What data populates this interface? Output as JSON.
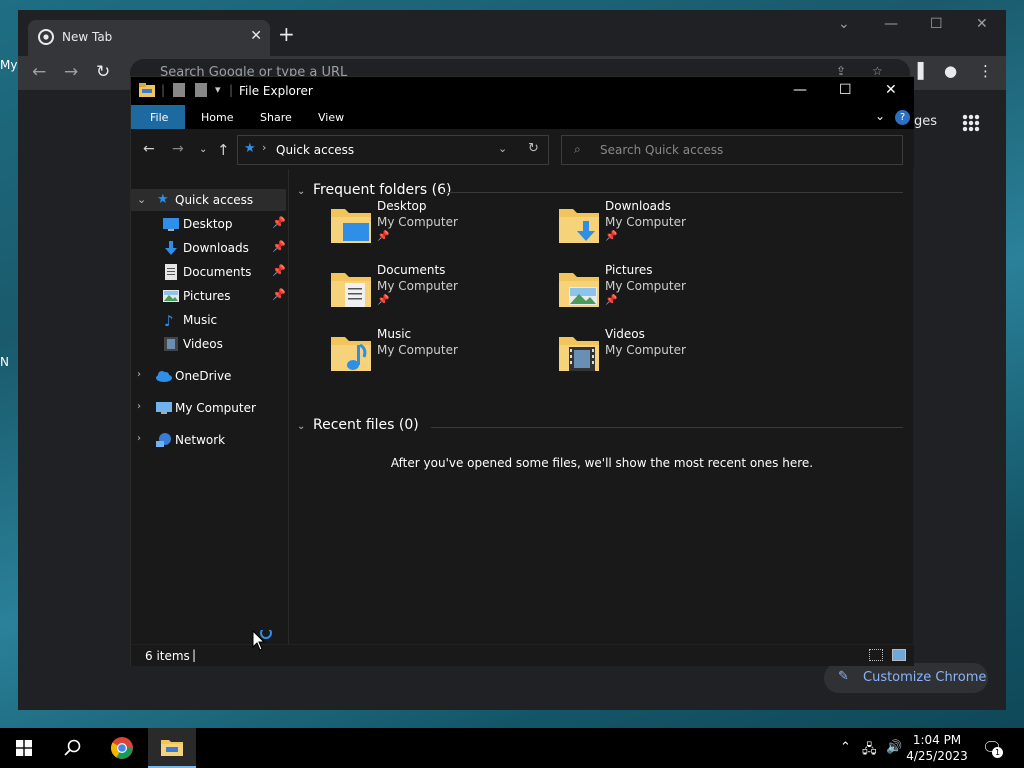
{
  "desktop": {
    "fragments": [
      "My",
      "N"
    ]
  },
  "chrome": {
    "tab_title": "New Tab",
    "tab_close": "✕",
    "new_tab": "+",
    "omnibox_placeholder": "Search Google or type a URL",
    "images_link_fragment": "ges",
    "customize_label": "Customize Chrome",
    "colors": {
      "frame": "#202124",
      "toolbar": "#35363a",
      "accent": "#8ab4f8"
    }
  },
  "explorer": {
    "title": "File Explorer",
    "ribbon_tabs": [
      "File",
      "Home",
      "Share",
      "View"
    ],
    "address_location": "Quick access",
    "search_placeholder": "Search Quick access",
    "nav": {
      "quick_access": "Quick access",
      "pinned": [
        {
          "label": "Desktop",
          "pinned": true,
          "icon": "desktop-icon"
        },
        {
          "label": "Downloads",
          "pinned": true,
          "icon": "downloads-icon"
        },
        {
          "label": "Documents",
          "pinned": true,
          "icon": "documents-icon"
        },
        {
          "label": "Pictures",
          "pinned": true,
          "icon": "pictures-icon"
        },
        {
          "label": "Music",
          "pinned": false,
          "icon": "music-icon"
        },
        {
          "label": "Videos",
          "pinned": false,
          "icon": "videos-icon"
        }
      ],
      "roots": [
        {
          "label": "OneDrive",
          "icon": "onedrive-icon"
        },
        {
          "label": "My Computer",
          "icon": "computer-icon"
        },
        {
          "label": "Network",
          "icon": "network-icon"
        }
      ]
    },
    "frequent_header": "Frequent folders (6)",
    "folders": [
      {
        "name": "Desktop",
        "location": "My Computer",
        "pinned": true,
        "icon": "desktop-folder-icon"
      },
      {
        "name": "Downloads",
        "location": "My Computer",
        "pinned": true,
        "icon": "downloads-folder-icon"
      },
      {
        "name": "Documents",
        "location": "My Computer",
        "pinned": true,
        "icon": "documents-folder-icon"
      },
      {
        "name": "Pictures",
        "location": "My Computer",
        "pinned": true,
        "icon": "pictures-folder-icon"
      },
      {
        "name": "Music",
        "location": "My Computer",
        "pinned": false,
        "icon": "music-folder-icon"
      },
      {
        "name": "Videos",
        "location": "My Computer",
        "pinned": false,
        "icon": "videos-folder-icon"
      }
    ],
    "recent_header": "Recent files (0)",
    "recent_empty_message": "After you've opened some files, we'll show the most recent ones here.",
    "status_items": "6 items",
    "colors": {
      "background": "#191919",
      "titlebar": "#000000",
      "file_tab": "#1c6aa0",
      "folder": "#f2c55c"
    }
  },
  "taskbar": {
    "time": "1:04 PM",
    "date": "4/25/2023",
    "notification_count": "1"
  }
}
